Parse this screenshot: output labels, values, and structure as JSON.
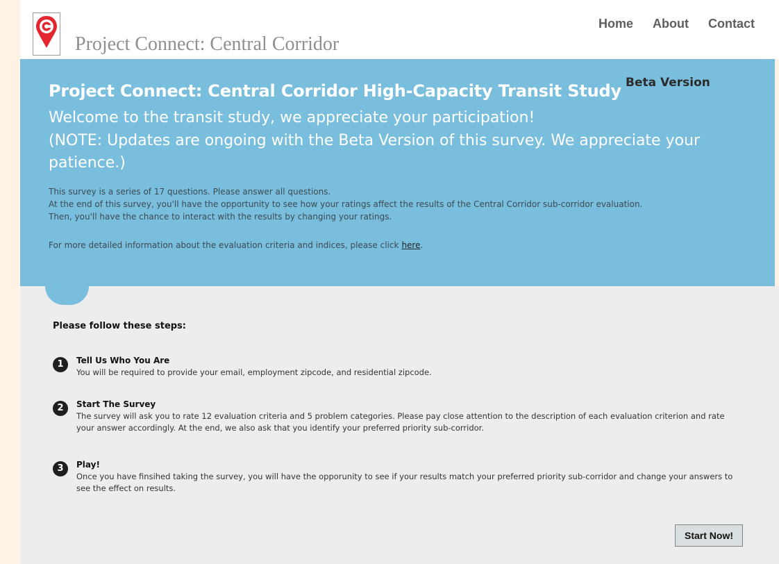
{
  "header": {
    "site_title": "Project Connect: Central Corridor",
    "nav": [
      "Home",
      "About",
      "Contact"
    ]
  },
  "hero": {
    "title": "Project Connect: Central Corridor High-Capacity Transit Study",
    "beta": "Beta Version",
    "welcome": "Welcome to the transit study, we appreciate your participation!",
    "note": "(NOTE: Updates are ongoing with the Beta Version of this survey. We appreciate your patience.)",
    "body": [
      "This survey is a series of 17 questions. Please answer all questions.",
      "At the end of this survey, you'll have the opportunity to see how your ratings affect the results of the Central Corridor sub-corridor evaluation.",
      "Then, you'll have the chance to interact with the results by changing your ratings."
    ],
    "more_text": "For more detailed information about the evaluation criteria and indices, please click",
    "more_link": "here",
    "more_suffix": "."
  },
  "steps": {
    "heading": "Please follow these steps:",
    "items": [
      {
        "num": "1",
        "title": "Tell Us Who You Are",
        "desc": "You will be required to provide your email, employment zipcode, and residential zipcode."
      },
      {
        "num": "2",
        "title": "Start The Survey",
        "desc": "The survey will ask you to rate 12 evaluation criteria and 5 problem categories. Please pay close attention to the description of each evaluation criterion and rate your answer accordingly. At the end, we also ask that you identify your preferred priority sub-corridor."
      },
      {
        "num": "3",
        "title": "Play!",
        "desc": "Once you have finsihed taking the survey, you will have the opporunity to see if your results match your preferred priority sub-corridor and change your answers to see the effect on results."
      }
    ],
    "start_button": "Start Now!"
  },
  "colors": {
    "hero_bg": "#79bedc",
    "page_bg": "#fdf2e3",
    "panel_bg": "#ededed",
    "logo_red": "#e3262f"
  },
  "icons": {
    "logo": "map-pin-icon"
  }
}
